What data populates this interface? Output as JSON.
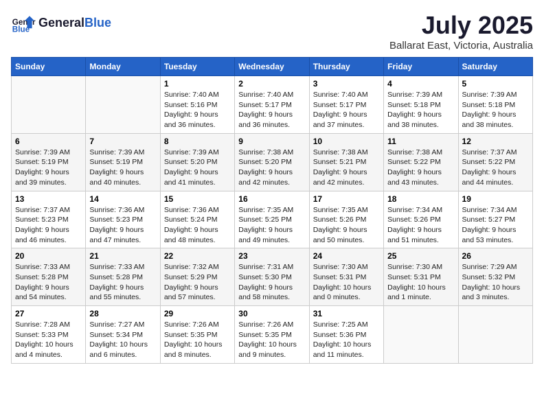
{
  "logo": {
    "text_general": "General",
    "text_blue": "Blue"
  },
  "title": "July 2025",
  "subtitle": "Ballarat East, Victoria, Australia",
  "days_header": [
    "Sunday",
    "Monday",
    "Tuesday",
    "Wednesday",
    "Thursday",
    "Friday",
    "Saturday"
  ],
  "weeks": [
    [
      {
        "day": "",
        "info": ""
      },
      {
        "day": "",
        "info": ""
      },
      {
        "day": "1",
        "info": "Sunrise: 7:40 AM\nSunset: 5:16 PM\nDaylight: 9 hours\nand 36 minutes."
      },
      {
        "day": "2",
        "info": "Sunrise: 7:40 AM\nSunset: 5:17 PM\nDaylight: 9 hours\nand 36 minutes."
      },
      {
        "day": "3",
        "info": "Sunrise: 7:40 AM\nSunset: 5:17 PM\nDaylight: 9 hours\nand 37 minutes."
      },
      {
        "day": "4",
        "info": "Sunrise: 7:39 AM\nSunset: 5:18 PM\nDaylight: 9 hours\nand 38 minutes."
      },
      {
        "day": "5",
        "info": "Sunrise: 7:39 AM\nSunset: 5:18 PM\nDaylight: 9 hours\nand 38 minutes."
      }
    ],
    [
      {
        "day": "6",
        "info": "Sunrise: 7:39 AM\nSunset: 5:19 PM\nDaylight: 9 hours\nand 39 minutes."
      },
      {
        "day": "7",
        "info": "Sunrise: 7:39 AM\nSunset: 5:19 PM\nDaylight: 9 hours\nand 40 minutes."
      },
      {
        "day": "8",
        "info": "Sunrise: 7:39 AM\nSunset: 5:20 PM\nDaylight: 9 hours\nand 41 minutes."
      },
      {
        "day": "9",
        "info": "Sunrise: 7:38 AM\nSunset: 5:20 PM\nDaylight: 9 hours\nand 42 minutes."
      },
      {
        "day": "10",
        "info": "Sunrise: 7:38 AM\nSunset: 5:21 PM\nDaylight: 9 hours\nand 42 minutes."
      },
      {
        "day": "11",
        "info": "Sunrise: 7:38 AM\nSunset: 5:22 PM\nDaylight: 9 hours\nand 43 minutes."
      },
      {
        "day": "12",
        "info": "Sunrise: 7:37 AM\nSunset: 5:22 PM\nDaylight: 9 hours\nand 44 minutes."
      }
    ],
    [
      {
        "day": "13",
        "info": "Sunrise: 7:37 AM\nSunset: 5:23 PM\nDaylight: 9 hours\nand 46 minutes."
      },
      {
        "day": "14",
        "info": "Sunrise: 7:36 AM\nSunset: 5:23 PM\nDaylight: 9 hours\nand 47 minutes."
      },
      {
        "day": "15",
        "info": "Sunrise: 7:36 AM\nSunset: 5:24 PM\nDaylight: 9 hours\nand 48 minutes."
      },
      {
        "day": "16",
        "info": "Sunrise: 7:35 AM\nSunset: 5:25 PM\nDaylight: 9 hours\nand 49 minutes."
      },
      {
        "day": "17",
        "info": "Sunrise: 7:35 AM\nSunset: 5:26 PM\nDaylight: 9 hours\nand 50 minutes."
      },
      {
        "day": "18",
        "info": "Sunrise: 7:34 AM\nSunset: 5:26 PM\nDaylight: 9 hours\nand 51 minutes."
      },
      {
        "day": "19",
        "info": "Sunrise: 7:34 AM\nSunset: 5:27 PM\nDaylight: 9 hours\nand 53 minutes."
      }
    ],
    [
      {
        "day": "20",
        "info": "Sunrise: 7:33 AM\nSunset: 5:28 PM\nDaylight: 9 hours\nand 54 minutes."
      },
      {
        "day": "21",
        "info": "Sunrise: 7:33 AM\nSunset: 5:28 PM\nDaylight: 9 hours\nand 55 minutes."
      },
      {
        "day": "22",
        "info": "Sunrise: 7:32 AM\nSunset: 5:29 PM\nDaylight: 9 hours\nand 57 minutes."
      },
      {
        "day": "23",
        "info": "Sunrise: 7:31 AM\nSunset: 5:30 PM\nDaylight: 9 hours\nand 58 minutes."
      },
      {
        "day": "24",
        "info": "Sunrise: 7:30 AM\nSunset: 5:31 PM\nDaylight: 10 hours\nand 0 minutes."
      },
      {
        "day": "25",
        "info": "Sunrise: 7:30 AM\nSunset: 5:31 PM\nDaylight: 10 hours\nand 1 minute."
      },
      {
        "day": "26",
        "info": "Sunrise: 7:29 AM\nSunset: 5:32 PM\nDaylight: 10 hours\nand 3 minutes."
      }
    ],
    [
      {
        "day": "27",
        "info": "Sunrise: 7:28 AM\nSunset: 5:33 PM\nDaylight: 10 hours\nand 4 minutes."
      },
      {
        "day": "28",
        "info": "Sunrise: 7:27 AM\nSunset: 5:34 PM\nDaylight: 10 hours\nand 6 minutes."
      },
      {
        "day": "29",
        "info": "Sunrise: 7:26 AM\nSunset: 5:35 PM\nDaylight: 10 hours\nand 8 minutes."
      },
      {
        "day": "30",
        "info": "Sunrise: 7:26 AM\nSunset: 5:35 PM\nDaylight: 10 hours\nand 9 minutes."
      },
      {
        "day": "31",
        "info": "Sunrise: 7:25 AM\nSunset: 5:36 PM\nDaylight: 10 hours\nand 11 minutes."
      },
      {
        "day": "",
        "info": ""
      },
      {
        "day": "",
        "info": ""
      }
    ]
  ]
}
